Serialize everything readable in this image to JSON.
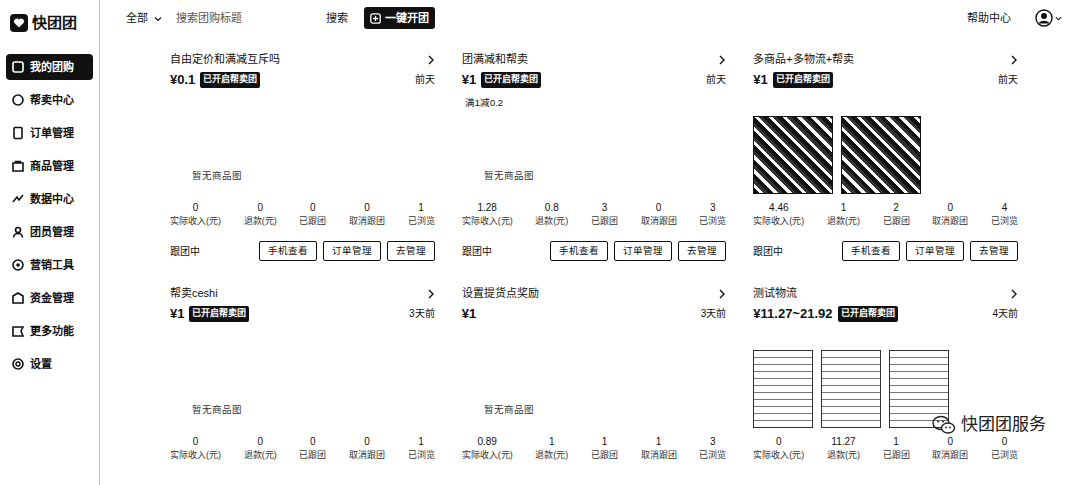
{
  "logo": {
    "text": "快团团"
  },
  "sidebar": {
    "items": [
      {
        "label": "我的团购",
        "selected": true
      },
      {
        "label": "帮卖中心",
        "selected": false
      },
      {
        "label": "订单管理",
        "selected": false
      },
      {
        "label": "商品管理",
        "selected": false
      },
      {
        "label": "数据中心",
        "selected": false
      },
      {
        "label": "团员管理",
        "selected": false
      },
      {
        "label": "营销工具",
        "selected": false
      },
      {
        "label": "资金管理",
        "selected": false
      },
      {
        "label": "更多功能",
        "selected": false
      },
      {
        "label": "设置",
        "selected": false
      }
    ]
  },
  "toolbar": {
    "filter": "全部",
    "search": {
      "placeholder": "搜索团购标题"
    },
    "search_button": "搜索",
    "create_button": "一键开团",
    "help": "帮助中心"
  },
  "cards": [
    {
      "title": "自由定价和满减互斥吗",
      "price": "¥0.1",
      "badge": "已开启帮卖团",
      "time": "前天",
      "promo": "",
      "empty_text": "暂无商品图",
      "images": [],
      "stats": [
        {
          "value": "0",
          "label": "实际收入(元)"
        },
        {
          "value": "0",
          "label": "退款(元)"
        },
        {
          "value": "0",
          "label": "已跟团"
        },
        {
          "value": "0",
          "label": "取消跟团"
        },
        {
          "value": "1",
          "label": "已浏览"
        }
      ],
      "status": "跟团中",
      "buttons": [
        "手机查看",
        "订单管理",
        "去管理"
      ]
    },
    {
      "title": "团满减和帮卖",
      "price": "¥1",
      "badge": "已开启帮卖团",
      "time": "前天",
      "promo": "满1减0.2",
      "empty_text": "暂无商品图",
      "images": [],
      "stats": [
        {
          "value": "1.28",
          "label": "实际收入(元)"
        },
        {
          "value": "0.8",
          "label": "退款(元)"
        },
        {
          "value": "3",
          "label": "已跟团"
        },
        {
          "value": "0",
          "label": "取消跟团"
        },
        {
          "value": "3",
          "label": "已浏览"
        }
      ],
      "status": "跟团中",
      "buttons": [
        "手机查看",
        "订单管理",
        "去管理"
      ]
    },
    {
      "title": "多商品+多物流+帮卖",
      "price": "¥1",
      "badge": "已开启帮卖团",
      "time": "前天",
      "promo": "",
      "empty_text": "",
      "images": [
        {
          "kind": "photo"
        },
        {
          "kind": "photo"
        }
      ],
      "stats": [
        {
          "value": "4.46",
          "label": "实际收入(元)"
        },
        {
          "value": "1",
          "label": "退款(元)"
        },
        {
          "value": "2",
          "label": "已跟团"
        },
        {
          "value": "0",
          "label": "取消跟团"
        },
        {
          "value": "4",
          "label": "已浏览"
        }
      ],
      "status": "跟团中",
      "buttons": [
        "手机查看",
        "订单管理",
        "去管理"
      ]
    },
    {
      "title": "帮卖ceshi",
      "price": "¥1",
      "badge": "已开启帮卖团",
      "time": "3天前",
      "promo": "",
      "empty_text": "暂无商品图",
      "images": [],
      "stats": [
        {
          "value": "0",
          "label": "实际收入(元)"
        },
        {
          "value": "0",
          "label": "退款(元)"
        },
        {
          "value": "0",
          "label": "已跟团"
        },
        {
          "value": "0",
          "label": "取消跟团"
        },
        {
          "value": "1",
          "label": "已浏览"
        }
      ],
      "status": "",
      "buttons": []
    },
    {
      "title": "设置提货点奖励",
      "price": "¥1",
      "badge": "",
      "time": "3天前",
      "promo": "",
      "empty_text": "暂无商品图",
      "images": [],
      "stats": [
        {
          "value": "0.89",
          "label": "实际收入(元)"
        },
        {
          "value": "1",
          "label": "退款(元)"
        },
        {
          "value": "1",
          "label": "已跟团"
        },
        {
          "value": "1",
          "label": "取消跟团"
        },
        {
          "value": "3",
          "label": "已浏览"
        }
      ],
      "status": "",
      "buttons": []
    },
    {
      "title": "测试物流",
      "price": "¥11.27~21.92",
      "badge": "已开启帮卖团",
      "time": "4天前",
      "promo": "",
      "empty_text": "",
      "images": [
        {
          "kind": "screenshot"
        },
        {
          "kind": "screenshot"
        },
        {
          "kind": "screenshot"
        }
      ],
      "stats": [
        {
          "value": "0",
          "label": "实际收入(元)"
        },
        {
          "value": "11.27",
          "label": "退款(元)"
        },
        {
          "value": "1",
          "label": "已跟团"
        },
        {
          "value": "0",
          "label": "取消跟团"
        },
        {
          "value": "0",
          "label": "已浏览"
        }
      ],
      "status": "",
      "buttons": []
    }
  ],
  "watermark": "快团团服务"
}
